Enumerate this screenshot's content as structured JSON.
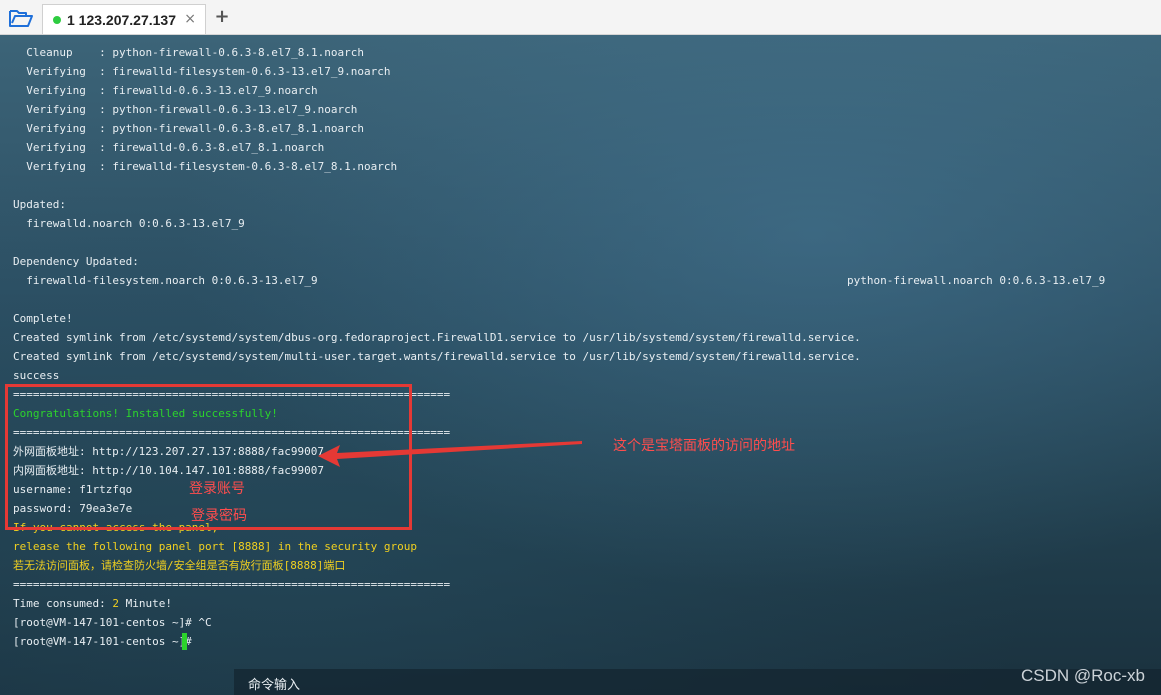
{
  "tab": {
    "title": "1 123.207.27.137",
    "close_glyph": "×",
    "add_glyph": "+",
    "status_color": "#2ecc40"
  },
  "icons": {
    "open": "open-folder-icon"
  },
  "terminal": {
    "lines": [
      "  Cleanup    : python-firewall-0.6.3-8.el7_8.1.noarch",
      "  Verifying  : firewalld-filesystem-0.6.3-13.el7_9.noarch",
      "  Verifying  : firewalld-0.6.3-13.el7_9.noarch",
      "  Verifying  : python-firewall-0.6.3-13.el7_9.noarch",
      "  Verifying  : python-firewall-0.6.3-8.el7_8.1.noarch",
      "  Verifying  : firewalld-0.6.3-8.el7_8.1.noarch",
      "  Verifying  : firewalld-filesystem-0.6.3-8.el7_8.1.noarch",
      "",
      "Updated:",
      "  firewalld.noarch 0:0.6.3-13.el7_9",
      "",
      "Dependency Updated:",
      "  firewalld-filesystem.noarch 0:0.6.3-13.el7_9",
      "",
      "Complete!",
      "Created symlink from /etc/systemd/system/dbus-org.fedoraproject.FirewallD1.service to /usr/lib/systemd/system/firewalld.service.",
      "Created symlink from /etc/systemd/system/multi-user.target.wants/firewalld.service to /usr/lib/systemd/system/firewalld.service.",
      "success",
      "==================================================================",
      "Congratulations! Installed successfully!",
      "==================================================================",
      "外网面板地址: http://123.207.27.137:8888/fac99007",
      "内网面板地址: http://10.104.147.101:8888/fac99007",
      "username: f1rtzfqo",
      "password: 79ea3e7e",
      "If you cannot access the panel,",
      "release the following panel port [8888] in the security group",
      "若无法访问面板，请检查防火墙/安全组是否有放行面板[8888]端口",
      "==================================================================",
      "Time consumed: ",
      "[root@VM-147-101-centos ~]# ^C",
      "[root@VM-147-101-centos ~]# "
    ],
    "dep_right": "python-firewall.noarch 0:0.6.3-13.el7_9",
    "time_value": "2",
    "time_unit": " Minute!",
    "colors": {
      "green": "#2cd32c",
      "yellow": "#f0d020",
      "text": "#e8eef2",
      "annotation": "#ff4d4d"
    }
  },
  "annotations": {
    "address_note": "这个是宝塔面板的访问的地址",
    "account_note": "登录账号",
    "password_note": "登录密码"
  },
  "command_bar": {
    "label": "命令输入"
  },
  "watermark": "CSDN @Roc-xb"
}
